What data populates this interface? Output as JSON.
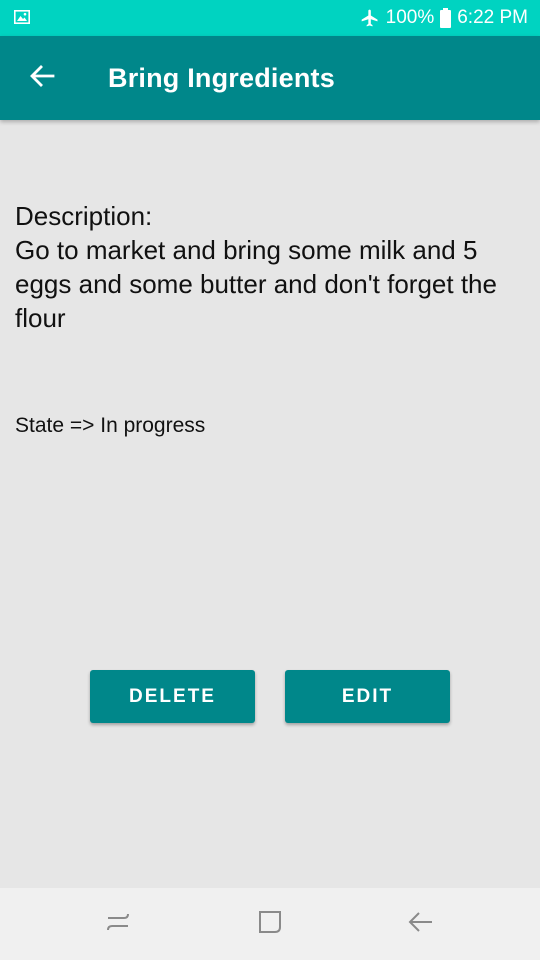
{
  "status_bar": {
    "battery": "100%",
    "time": "6:22 PM"
  },
  "app_bar": {
    "title": "Bring Ingredients"
  },
  "content": {
    "description_label": "Description:",
    "description_text": "Go to market and bring some milk and 5 eggs and some butter and don't forget the flour",
    "state_text": "State => In progress"
  },
  "buttons": {
    "delete_label": "DELETE",
    "edit_label": "EDIT"
  },
  "icons": {
    "status_left": "gallery-icon",
    "airplane": "airplane-mode-icon",
    "battery": "battery-icon",
    "back": "arrow-back-icon",
    "nav_recents": "recents-icon",
    "nav_home": "home-icon",
    "nav_back": "nav-back-icon"
  },
  "colors": {
    "status_bar": "#00d3c1",
    "app_bar": "#00878a",
    "background": "#e6e6e6",
    "button": "#00878a"
  }
}
